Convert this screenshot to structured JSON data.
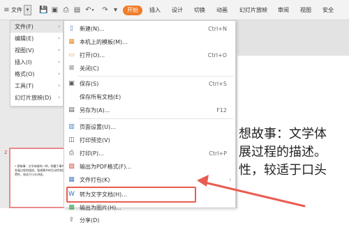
{
  "ribbon": {
    "file_label": "文件",
    "tabs": [
      "开始",
      "插入",
      "设计",
      "切换",
      "动画",
      "幻灯片放映",
      "审阅",
      "视图",
      "安全"
    ],
    "toolbar_icons": [
      "save-icon",
      "print-preview-icon",
      "print-icon",
      "export-pdf-icon",
      "undo-icon",
      "redo-icon",
      "more-icon"
    ]
  },
  "main_menu": {
    "items": [
      {
        "label": "文件(F)",
        "arrow": "›"
      },
      {
        "label": "编辑(E)",
        "arrow": "›"
      },
      {
        "label": "视图(V)",
        "arrow": "›"
      },
      {
        "label": "插入(I)",
        "arrow": "›"
      },
      {
        "label": "格式(O)",
        "arrow": "›"
      },
      {
        "label": "工具(T)",
        "arrow": "›"
      },
      {
        "label": "幻灯片放映(D)",
        "arrow": "›"
      }
    ]
  },
  "sub_menu": {
    "items": [
      {
        "label": "新建(N)...",
        "shortcut": "Ctrl+N",
        "icon": "new-file-icon"
      },
      {
        "label": "本机上的模板(M)...",
        "shortcut": "",
        "icon": "template-icon"
      },
      {
        "label": "打开(O)...",
        "shortcut": "Ctrl+O",
        "icon": "open-folder-icon"
      },
      {
        "label": "关闭(C)",
        "shortcut": "",
        "icon": "close-icon"
      },
      {
        "label": "保存(S)",
        "shortcut": "Ctrl+S",
        "icon": "save-icon"
      },
      {
        "label": "保存所有文档(E)",
        "shortcut": "",
        "icon": ""
      },
      {
        "label": "另存为(A)...",
        "shortcut": "F12",
        "icon": "save-as-icon"
      },
      {
        "label": "页面设置(U)...",
        "shortcut": "",
        "icon": "page-setup-icon"
      },
      {
        "label": "打印预览(V)",
        "shortcut": "",
        "icon": "print-preview-icon"
      },
      {
        "label": "打印(P)...",
        "shortcut": "Ctrl+P",
        "icon": "print-icon"
      },
      {
        "label": "输出为PDF格式(F)...",
        "shortcut": "",
        "icon": "pdf-icon"
      },
      {
        "label": "文件打包(K)",
        "shortcut": "",
        "icon": "package-icon"
      },
      {
        "label": "转为文字文档(H)...",
        "shortcut": "",
        "icon": "convert-to-doc-icon"
      },
      {
        "label": "输出为图片(H)...",
        "shortcut": "",
        "icon": "export-image-icon"
      },
      {
        "label": "分享(D)",
        "shortcut": "",
        "icon": "share-icon"
      }
    ]
  },
  "slide": {
    "lines": [
      "想故事：文学体",
      "展过程的描述。",
      "性，较适于口头"
    ]
  },
  "thumbnail": {
    "number": "2",
    "text": "• 想故事：文学体裁的一种，侧重于事件发展过程的描述。强调情节的生动性和连贯性，较适于口头讲述。"
  },
  "colors": {
    "accent": "#f07c2a",
    "highlight": "#e85c50"
  }
}
